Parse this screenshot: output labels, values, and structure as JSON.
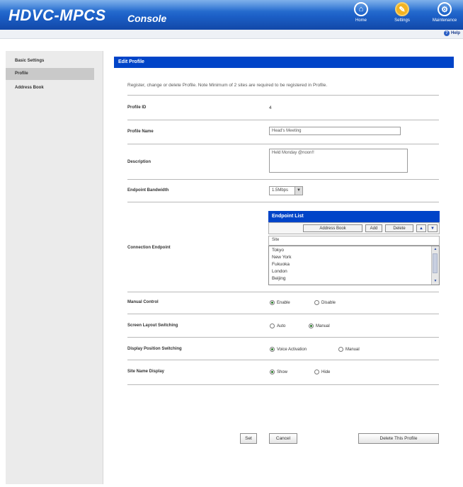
{
  "header": {
    "app_name": "HDVC-MPCS",
    "section": "Console",
    "buttons": [
      {
        "label": "Home",
        "icon": "home-icon"
      },
      {
        "label": "Settings",
        "icon": "wrench-icon"
      },
      {
        "label": "Maintenance",
        "icon": "maintenance-icon"
      }
    ],
    "help_label": "Help"
  },
  "sidebar": {
    "items": [
      {
        "label": "Basic Settings",
        "active": false
      },
      {
        "label": "Profile",
        "active": true
      },
      {
        "label": "Address Book",
        "active": false
      }
    ]
  },
  "panel": {
    "title": "Edit Profile",
    "note": "Register, change or delete Profile. Note Minimum of 2 sites are required to be registered in Profile."
  },
  "form": {
    "profile_id": {
      "label": "Profile ID",
      "value": "4"
    },
    "profile_name": {
      "label": "Profile Name",
      "value": "Head's Meeting"
    },
    "description": {
      "label": "Description",
      "value": "Held Monday @noon!!"
    },
    "bandwidth": {
      "label": "Endpoint Bandwidth",
      "value": "1.5Mbps"
    },
    "connection": {
      "label": "Connection Endpoint"
    },
    "manual_control": {
      "label": "Manual Control",
      "options": [
        "Enable",
        "Disable"
      ],
      "selected": "Enable"
    },
    "screen_layout": {
      "label": "Screen Layout Switching",
      "options": [
        "Auto",
        "Manual"
      ],
      "selected": "Manual"
    },
    "display_position": {
      "label": "Display Position Switching",
      "options": [
        "Voice Activation",
        "Manual"
      ],
      "selected": "Voice Activation"
    },
    "site_name_display": {
      "label": "Site Name Display",
      "options": [
        "Show",
        "Hide"
      ],
      "selected": "Show"
    }
  },
  "endpoint_list": {
    "title": "Endpoint List",
    "buttons": {
      "address_book": "Address Book",
      "add": "Add",
      "delete": "Delete",
      "up": "▲",
      "down": "▼"
    },
    "column_header": "Site",
    "items": [
      "Tokyo",
      "New York",
      "Fukuoka",
      "London",
      "Beijing"
    ]
  },
  "actions": {
    "set": "Set",
    "cancel": "Cancel",
    "delete_profile": "Delete This Profile"
  },
  "colors": {
    "header_blue": "#1c5fc6",
    "panel_blue": "#0044c8",
    "sidebar_bg": "#ebebeb"
  }
}
